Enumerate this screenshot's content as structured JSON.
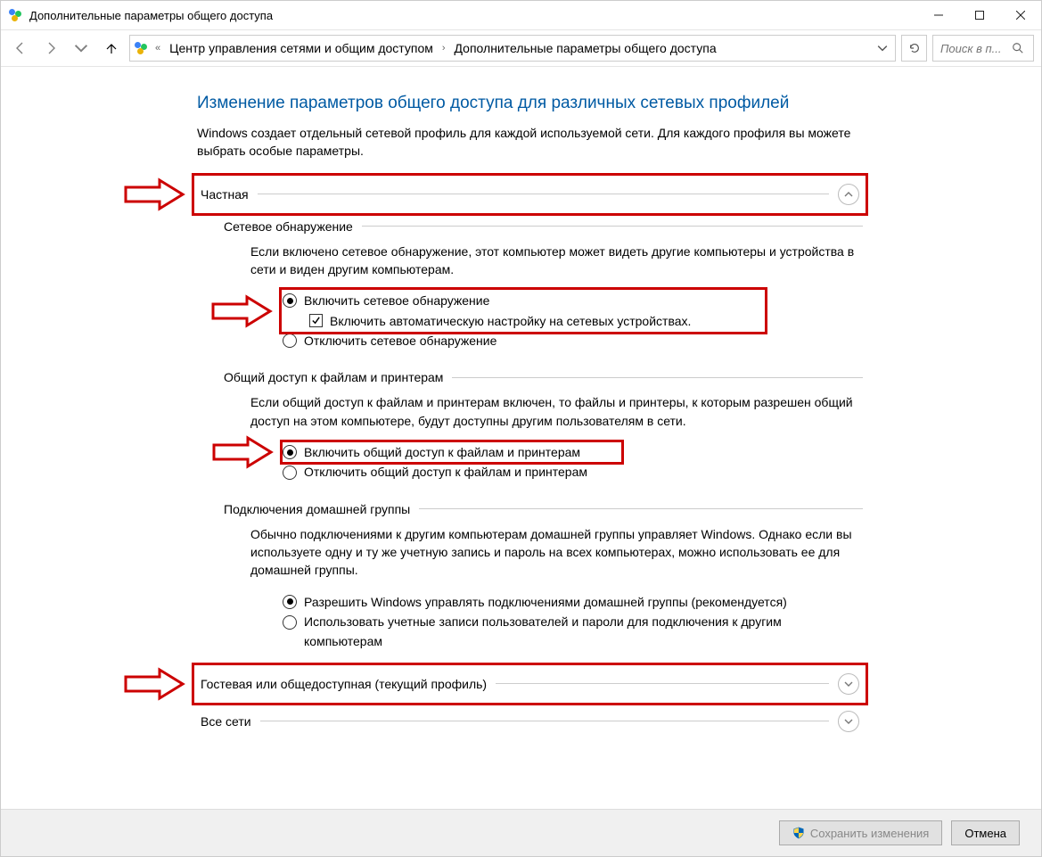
{
  "window": {
    "title": "Дополнительные параметры общего доступа"
  },
  "breadcrumbs": {
    "overflow": "«",
    "item1": "Центр управления сетями и общим доступом",
    "item2": "Дополнительные параметры общего доступа"
  },
  "search": {
    "placeholder": "Поиск в п..."
  },
  "heading": "Изменение параметров общего доступа для различных сетевых профилей",
  "subheading": "Windows создает отдельный сетевой профиль для каждой используемой сети. Для каждого профиля вы можете выбрать особые параметры.",
  "profile_private": {
    "title": "Частная",
    "discovery": {
      "title": "Сетевое обнаружение",
      "desc": "Если включено сетевое обнаружение, этот компьютер может видеть другие компьютеры и устройства в сети и виден другим компьютерам.",
      "radio_on": "Включить сетевое обнаружение",
      "check_auto": "Включить автоматическую настройку на сетевых устройствах.",
      "radio_off": "Отключить сетевое обнаружение"
    },
    "file_share": {
      "title": "Общий доступ к файлам и принтерам",
      "desc": "Если общий доступ к файлам и принтерам включен, то файлы и принтеры, к которым разрешен общий доступ на этом компьютере, будут доступны другим пользователям в сети.",
      "radio_on": "Включить общий доступ к файлам и принтерам",
      "radio_off": "Отключить общий доступ к файлам и принтерам"
    },
    "homegroup": {
      "title": "Подключения домашней группы",
      "desc": "Обычно подключениями к другим компьютерам домашней группы управляет Windows. Однако если вы используете одну и ту же учетную запись и пароль на всех компьютерах, можно использовать ее для домашней группы.",
      "radio_windows": "Разрешить Windows управлять подключениями домашней группы (рекомендуется)",
      "radio_user": "Использовать учетные записи пользователей и пароли для подключения к другим компьютерам"
    }
  },
  "profile_guest": {
    "title": "Гостевая или общедоступная (текущий профиль)"
  },
  "profile_all": {
    "title": "Все сети"
  },
  "footer": {
    "save": "Сохранить изменения",
    "cancel": "Отмена"
  }
}
